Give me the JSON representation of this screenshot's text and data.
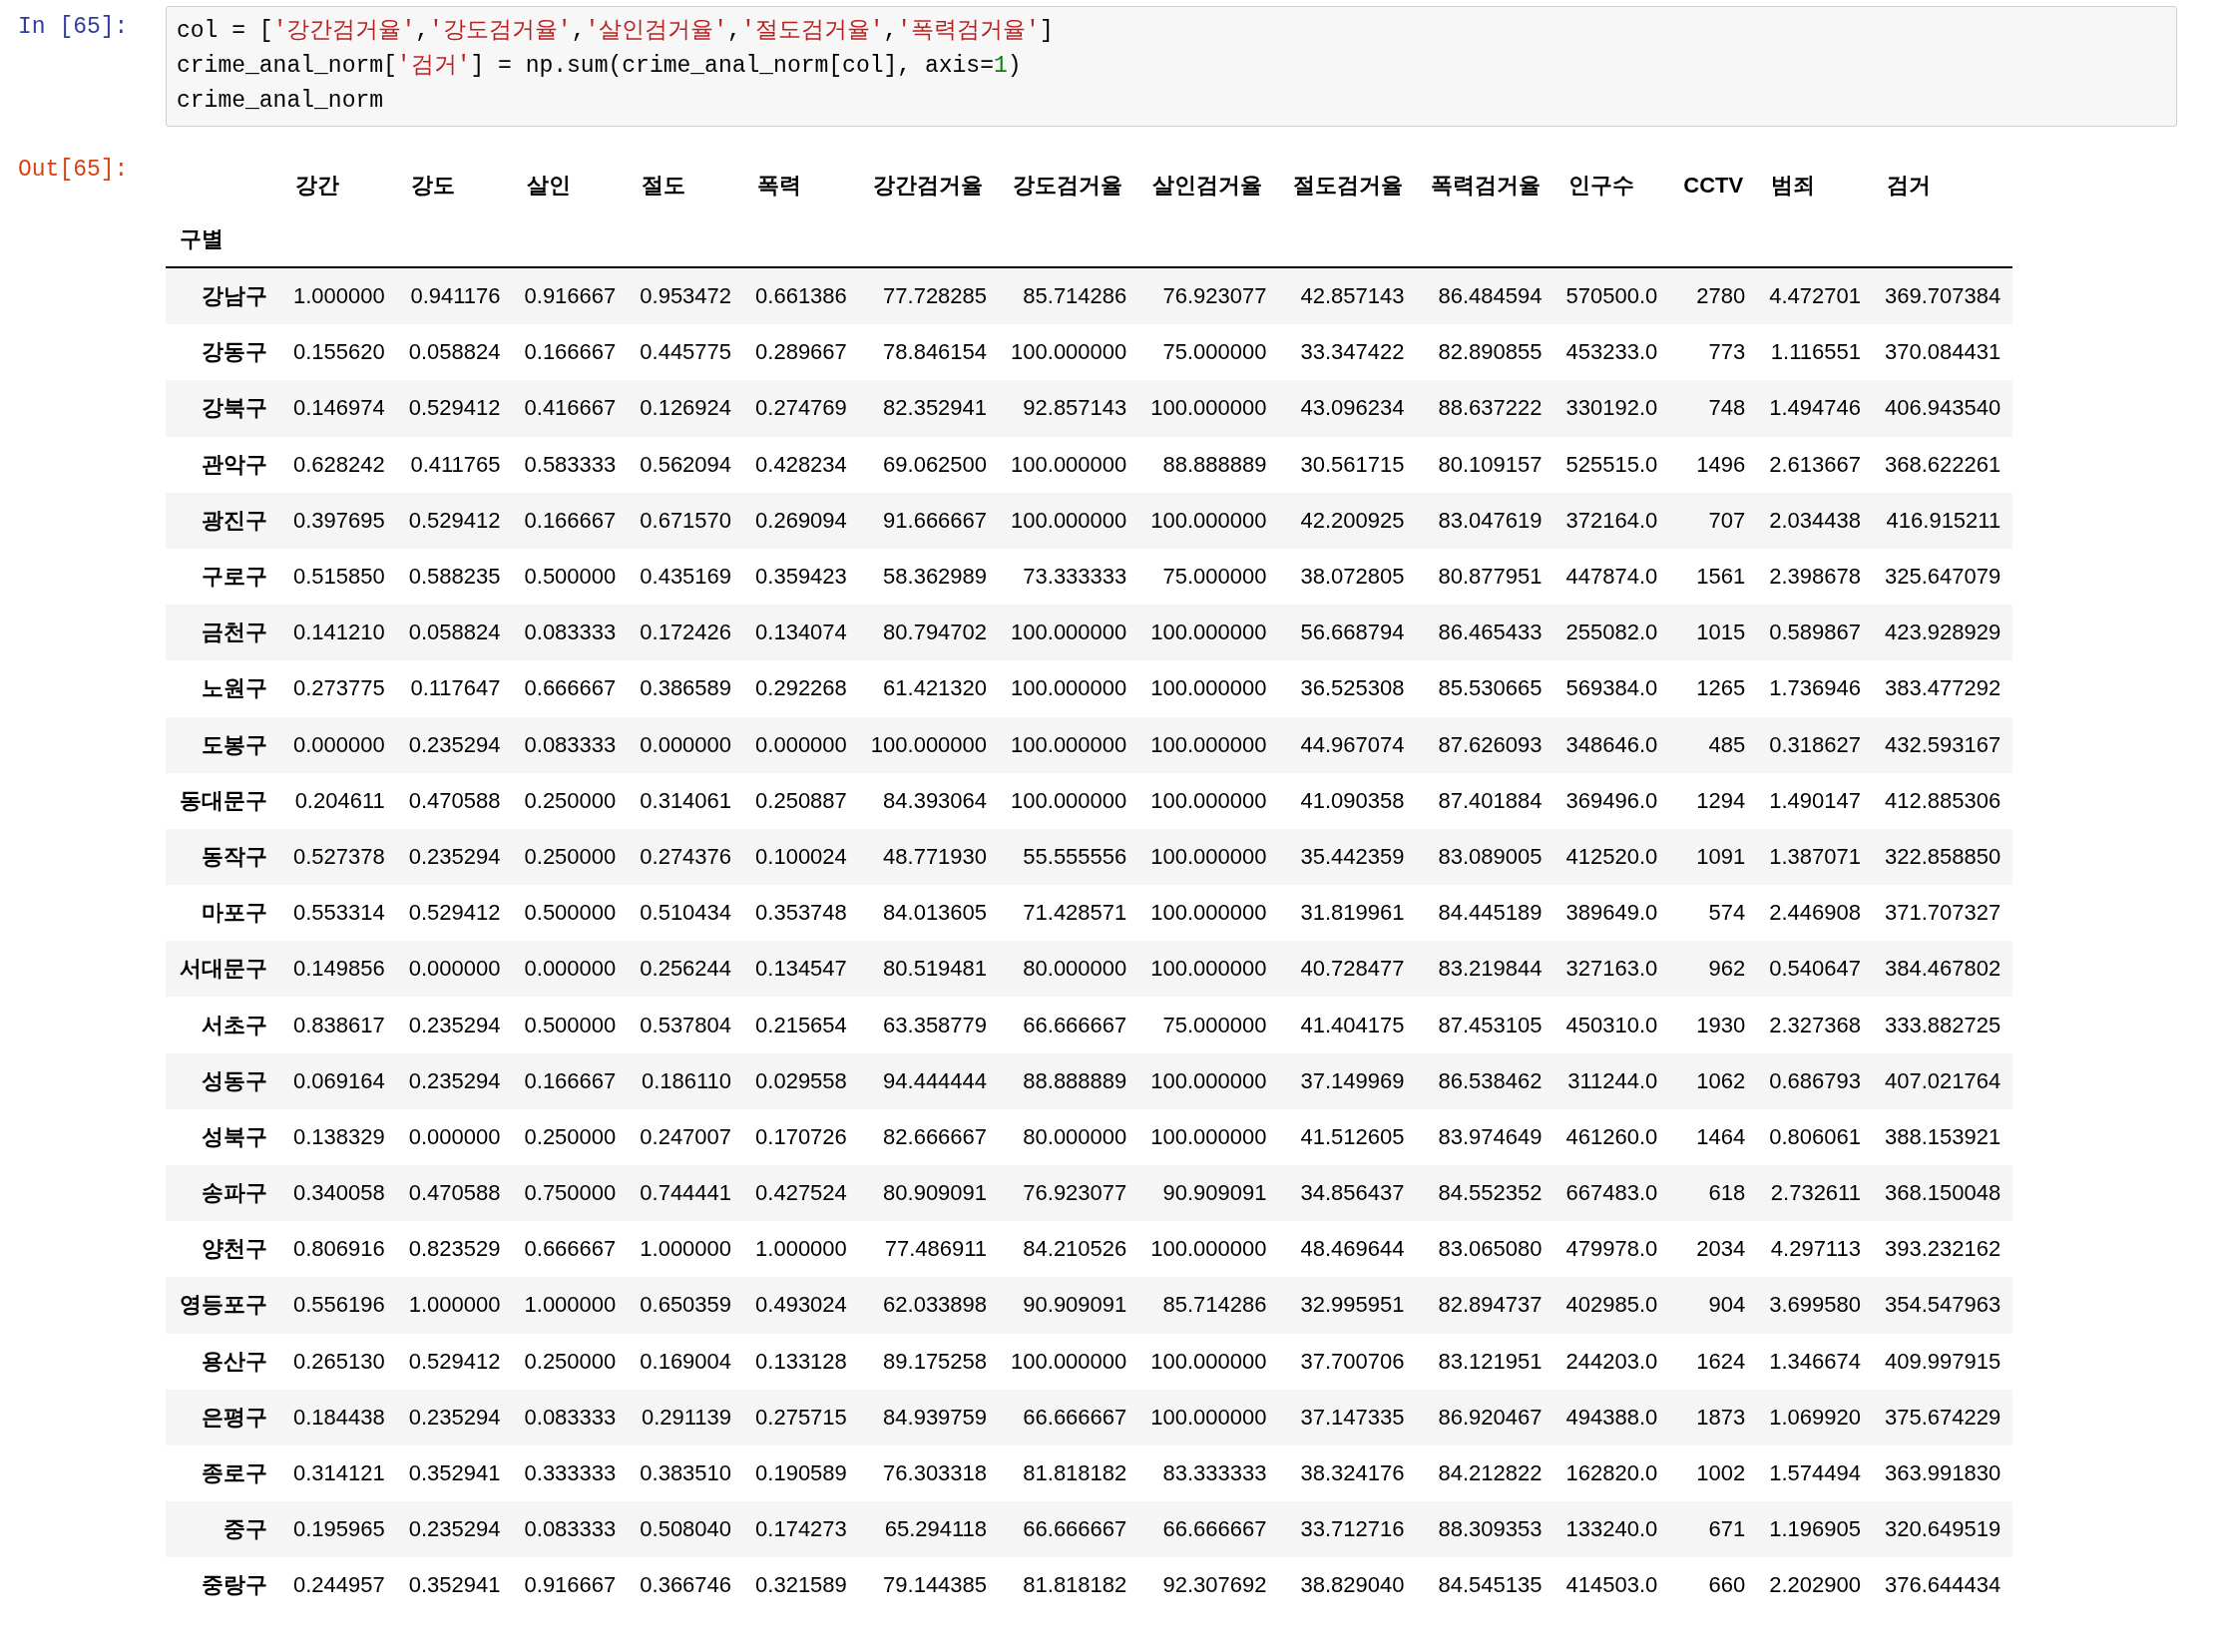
{
  "input_cell": {
    "prompt": "In [65]:",
    "lines": [
      [
        {
          "kind": "plain",
          "text": "col = ["
        },
        {
          "kind": "string",
          "text": "'강간검거율'"
        },
        {
          "kind": "plain",
          "text": ","
        },
        {
          "kind": "string",
          "text": "'강도검거율'"
        },
        {
          "kind": "plain",
          "text": ","
        },
        {
          "kind": "string",
          "text": "'살인검거율'"
        },
        {
          "kind": "plain",
          "text": ","
        },
        {
          "kind": "string",
          "text": "'절도검거율'"
        },
        {
          "kind": "plain",
          "text": ","
        },
        {
          "kind": "string",
          "text": "'폭력검거율'"
        },
        {
          "kind": "plain",
          "text": "]"
        }
      ],
      [
        {
          "kind": "plain",
          "text": "crime_anal_norm["
        },
        {
          "kind": "string",
          "text": "'검거'"
        },
        {
          "kind": "plain",
          "text": "] = np.sum(crime_anal_norm[col], axis="
        },
        {
          "kind": "number",
          "text": "1"
        },
        {
          "kind": "plain",
          "text": ")"
        }
      ],
      [
        {
          "kind": "plain",
          "text": "crime_anal_norm"
        }
      ]
    ]
  },
  "output_cell": {
    "prompt": "Out[65]:",
    "table": {
      "columns": [
        "강간",
        "강도",
        "살인",
        "절도",
        "폭력",
        "강간검거율",
        "강도검거율",
        "살인검거율",
        "절도검거율",
        "폭력검거율",
        "인구수",
        "CCTV",
        "범죄",
        "검거"
      ],
      "index_name": "구별",
      "rows": [
        {
          "index": "강남구",
          "cells": [
            "1.000000",
            "0.941176",
            "0.916667",
            "0.953472",
            "0.661386",
            "77.728285",
            "85.714286",
            "76.923077",
            "42.857143",
            "86.484594",
            "570500.0",
            "2780",
            "4.472701",
            "369.707384"
          ]
        },
        {
          "index": "강동구",
          "cells": [
            "0.155620",
            "0.058824",
            "0.166667",
            "0.445775",
            "0.289667",
            "78.846154",
            "100.000000",
            "75.000000",
            "33.347422",
            "82.890855",
            "453233.0",
            "773",
            "1.116551",
            "370.084431"
          ]
        },
        {
          "index": "강북구",
          "cells": [
            "0.146974",
            "0.529412",
            "0.416667",
            "0.126924",
            "0.274769",
            "82.352941",
            "92.857143",
            "100.000000",
            "43.096234",
            "88.637222",
            "330192.0",
            "748",
            "1.494746",
            "406.943540"
          ]
        },
        {
          "index": "관악구",
          "cells": [
            "0.628242",
            "0.411765",
            "0.583333",
            "0.562094",
            "0.428234",
            "69.062500",
            "100.000000",
            "88.888889",
            "30.561715",
            "80.109157",
            "525515.0",
            "1496",
            "2.613667",
            "368.622261"
          ]
        },
        {
          "index": "광진구",
          "cells": [
            "0.397695",
            "0.529412",
            "0.166667",
            "0.671570",
            "0.269094",
            "91.666667",
            "100.000000",
            "100.000000",
            "42.200925",
            "83.047619",
            "372164.0",
            "707",
            "2.034438",
            "416.915211"
          ]
        },
        {
          "index": "구로구",
          "cells": [
            "0.515850",
            "0.588235",
            "0.500000",
            "0.435169",
            "0.359423",
            "58.362989",
            "73.333333",
            "75.000000",
            "38.072805",
            "80.877951",
            "447874.0",
            "1561",
            "2.398678",
            "325.647079"
          ]
        },
        {
          "index": "금천구",
          "cells": [
            "0.141210",
            "0.058824",
            "0.083333",
            "0.172426",
            "0.134074",
            "80.794702",
            "100.000000",
            "100.000000",
            "56.668794",
            "86.465433",
            "255082.0",
            "1015",
            "0.589867",
            "423.928929"
          ]
        },
        {
          "index": "노원구",
          "cells": [
            "0.273775",
            "0.117647",
            "0.666667",
            "0.386589",
            "0.292268",
            "61.421320",
            "100.000000",
            "100.000000",
            "36.525308",
            "85.530665",
            "569384.0",
            "1265",
            "1.736946",
            "383.477292"
          ]
        },
        {
          "index": "도봉구",
          "cells": [
            "0.000000",
            "0.235294",
            "0.083333",
            "0.000000",
            "0.000000",
            "100.000000",
            "100.000000",
            "100.000000",
            "44.967074",
            "87.626093",
            "348646.0",
            "485",
            "0.318627",
            "432.593167"
          ]
        },
        {
          "index": "동대문구",
          "cells": [
            "0.204611",
            "0.470588",
            "0.250000",
            "0.314061",
            "0.250887",
            "84.393064",
            "100.000000",
            "100.000000",
            "41.090358",
            "87.401884",
            "369496.0",
            "1294",
            "1.490147",
            "412.885306"
          ]
        },
        {
          "index": "동작구",
          "cells": [
            "0.527378",
            "0.235294",
            "0.250000",
            "0.274376",
            "0.100024",
            "48.771930",
            "55.555556",
            "100.000000",
            "35.442359",
            "83.089005",
            "412520.0",
            "1091",
            "1.387071",
            "322.858850"
          ]
        },
        {
          "index": "마포구",
          "cells": [
            "0.553314",
            "0.529412",
            "0.500000",
            "0.510434",
            "0.353748",
            "84.013605",
            "71.428571",
            "100.000000",
            "31.819961",
            "84.445189",
            "389649.0",
            "574",
            "2.446908",
            "371.707327"
          ]
        },
        {
          "index": "서대문구",
          "cells": [
            "0.149856",
            "0.000000",
            "0.000000",
            "0.256244",
            "0.134547",
            "80.519481",
            "80.000000",
            "100.000000",
            "40.728477",
            "83.219844",
            "327163.0",
            "962",
            "0.540647",
            "384.467802"
          ]
        },
        {
          "index": "서초구",
          "cells": [
            "0.838617",
            "0.235294",
            "0.500000",
            "0.537804",
            "0.215654",
            "63.358779",
            "66.666667",
            "75.000000",
            "41.404175",
            "87.453105",
            "450310.0",
            "1930",
            "2.327368",
            "333.882725"
          ]
        },
        {
          "index": "성동구",
          "cells": [
            "0.069164",
            "0.235294",
            "0.166667",
            "0.186110",
            "0.029558",
            "94.444444",
            "88.888889",
            "100.000000",
            "37.149969",
            "86.538462",
            "311244.0",
            "1062",
            "0.686793",
            "407.021764"
          ]
        },
        {
          "index": "성북구",
          "cells": [
            "0.138329",
            "0.000000",
            "0.250000",
            "0.247007",
            "0.170726",
            "82.666667",
            "80.000000",
            "100.000000",
            "41.512605",
            "83.974649",
            "461260.0",
            "1464",
            "0.806061",
            "388.153921"
          ]
        },
        {
          "index": "송파구",
          "cells": [
            "0.340058",
            "0.470588",
            "0.750000",
            "0.744441",
            "0.427524",
            "80.909091",
            "76.923077",
            "90.909091",
            "34.856437",
            "84.552352",
            "667483.0",
            "618",
            "2.732611",
            "368.150048"
          ]
        },
        {
          "index": "양천구",
          "cells": [
            "0.806916",
            "0.823529",
            "0.666667",
            "1.000000",
            "1.000000",
            "77.486911",
            "84.210526",
            "100.000000",
            "48.469644",
            "83.065080",
            "479978.0",
            "2034",
            "4.297113",
            "393.232162"
          ]
        },
        {
          "index": "영등포구",
          "cells": [
            "0.556196",
            "1.000000",
            "1.000000",
            "0.650359",
            "0.493024",
            "62.033898",
            "90.909091",
            "85.714286",
            "32.995951",
            "82.894737",
            "402985.0",
            "904",
            "3.699580",
            "354.547963"
          ]
        },
        {
          "index": "용산구",
          "cells": [
            "0.265130",
            "0.529412",
            "0.250000",
            "0.169004",
            "0.133128",
            "89.175258",
            "100.000000",
            "100.000000",
            "37.700706",
            "83.121951",
            "244203.0",
            "1624",
            "1.346674",
            "409.997915"
          ]
        },
        {
          "index": "은평구",
          "cells": [
            "0.184438",
            "0.235294",
            "0.083333",
            "0.291139",
            "0.275715",
            "84.939759",
            "66.666667",
            "100.000000",
            "37.147335",
            "86.920467",
            "494388.0",
            "1873",
            "1.069920",
            "375.674229"
          ]
        },
        {
          "index": "종로구",
          "cells": [
            "0.314121",
            "0.352941",
            "0.333333",
            "0.383510",
            "0.190589",
            "76.303318",
            "81.818182",
            "83.333333",
            "38.324176",
            "84.212822",
            "162820.0",
            "1002",
            "1.574494",
            "363.991830"
          ]
        },
        {
          "index": "중구",
          "cells": [
            "0.195965",
            "0.235294",
            "0.083333",
            "0.508040",
            "0.174273",
            "65.294118",
            "66.666667",
            "66.666667",
            "33.712716",
            "88.309353",
            "133240.0",
            "671",
            "1.196905",
            "320.649519"
          ]
        },
        {
          "index": "중랑구",
          "cells": [
            "0.244957",
            "0.352941",
            "0.916667",
            "0.366746",
            "0.321589",
            "79.144385",
            "81.818182",
            "92.307692",
            "38.829040",
            "84.545135",
            "414503.0",
            "660",
            "2.202900",
            "376.644434"
          ]
        }
      ]
    }
  }
}
